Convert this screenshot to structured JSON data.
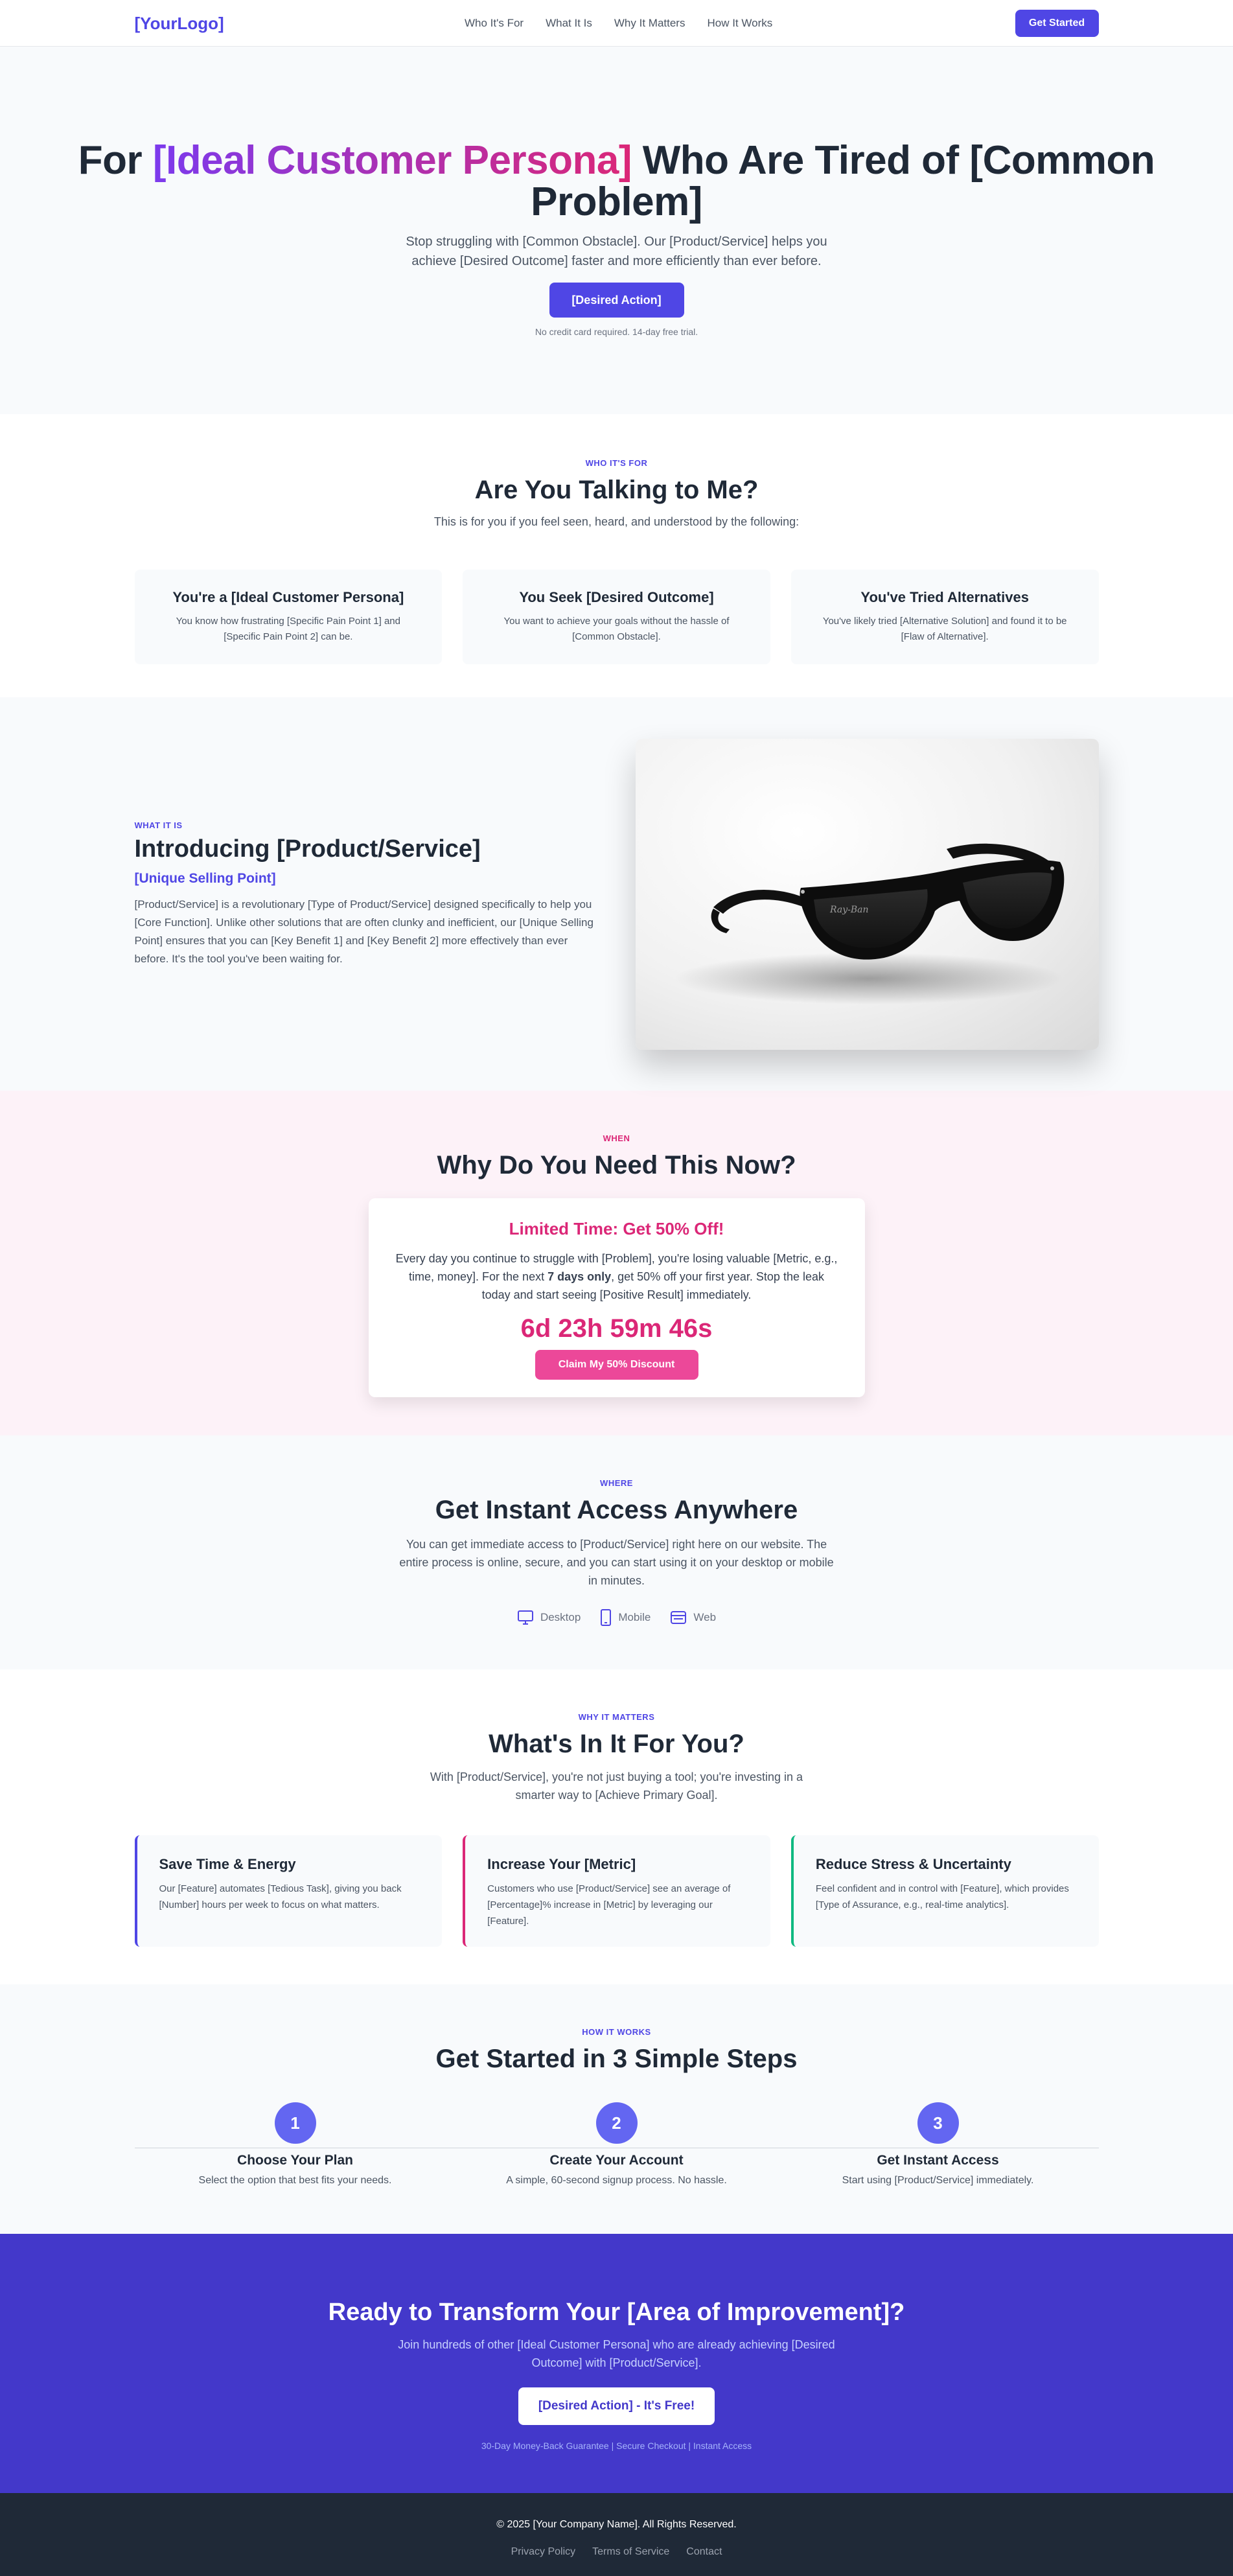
{
  "nav": {
    "logo": "[YourLogo]",
    "links": [
      "Who It's For",
      "What It Is",
      "Why It Matters",
      "How It Works"
    ],
    "cta": "Get Started"
  },
  "hero": {
    "title_start": "For ",
    "title_highlight": "[Ideal Customer Persona]",
    "title_end": " Who Are Tired of [Common Problem]",
    "subtitle": "Stop struggling with [Common Obstacle]. Our [Product/Service] helps you achieve [Desired Outcome] faster and more efficiently than ever before.",
    "cta": "[Desired Action]",
    "note": "No credit card required. 14-day free trial."
  },
  "who": {
    "eyebrow": "WHO IT'S FOR",
    "title": "Are You Talking to Me?",
    "lead": "This is for you if you feel seen, heard, and understood by the following:",
    "cards": [
      {
        "title": "You're a [Ideal Customer Persona]",
        "text": "You know how frustrating [Specific Pain Point 1] and [Specific Pain Point 2] can be."
      },
      {
        "title": "You Seek [Desired Outcome]",
        "text": "You want to achieve your goals without the hassle of [Common Obstacle]."
      },
      {
        "title": "You've Tried Alternatives",
        "text": "You've likely tried [Alternative Solution] and found it to be [Flaw of Alternative]."
      }
    ]
  },
  "what": {
    "eyebrow": "WHAT IT IS",
    "title": "Introducing [Product/Service]",
    "usp": "[Unique Selling Point]",
    "text": "[Product/Service] is a revolutionary [Type of Product/Service] designed specifically to help you [Core Function]. Unlike other solutions that are often clunky and inefficient, our [Unique Selling Point] ensures that you can [Key Benefit 1] and [Key Benefit 2] more effectively than ever before. It's the tool you've been waiting for.",
    "image_logo": "Ray-Ban"
  },
  "when": {
    "eyebrow": "WHEN",
    "title": "Why Do You Need This Now?",
    "offer_title": "Limited Time: Get 50% Off!",
    "offer_text_1": "Every day you continue to struggle with [Problem], you're losing valuable [Metric, e.g., time, money]. For the next ",
    "offer_text_bold": "7 days only",
    "offer_text_2": ", get 50% off your first year. Stop the leak today and start seeing [Positive Result] immediately.",
    "timer": "6d 23h 59m 46s",
    "cta": "Claim My 50% Discount"
  },
  "where": {
    "eyebrow": "WHERE",
    "title": "Get Instant Access Anywhere",
    "lead": "You can get immediate access to [Product/Service] right here on our website. The entire process is online, secure, and you can start using it on your desktop or mobile in minutes.",
    "platforms": [
      "Desktop",
      "Mobile",
      "Web"
    ]
  },
  "why": {
    "eyebrow": "WHY IT MATTERS",
    "title": "What's In It For You?",
    "lead": "With [Product/Service], you're not just buying a tool; you're investing in a smarter way to [Achieve Primary Goal].",
    "features": [
      {
        "title": "Save Time & Energy",
        "text": "Our [Feature] automates [Tedious Task], giving you back [Number] hours per week to focus on what matters.",
        "color": "#4f46e5"
      },
      {
        "title": "Increase Your [Metric]",
        "text": "Customers who use [Product/Service] see an average of [Percentage]% increase in [Metric] by leveraging our [Feature].",
        "color": "#db2777"
      },
      {
        "title": "Reduce Stress & Uncertainty",
        "text": "Feel confident and in control with [Feature], which provides [Type of Assurance, e.g., real-time analytics].",
        "color": "#10b981"
      }
    ]
  },
  "how": {
    "eyebrow": "HOW IT WORKS",
    "title": "Get Started in 3 Simple Steps",
    "steps": [
      {
        "num": "1",
        "title": "Choose Your Plan",
        "text": "Select the option that best fits your needs."
      },
      {
        "num": "2",
        "title": "Create Your Account",
        "text": "A simple, 60-second signup process. No hassle."
      },
      {
        "num": "3",
        "title": "Get Instant Access",
        "text": "Start using [Product/Service] immediately."
      }
    ]
  },
  "cta": {
    "title": "Ready to Transform Your [Area of Improvement]?",
    "lead": "Join hundreds of other [Ideal Customer Persona] who are already achieving [Desired Outcome] with [Product/Service].",
    "button": "[Desired Action] - It's Free!",
    "small": "30-Day Money-Back Guarantee | Secure Checkout | Instant Access"
  },
  "footer": {
    "copy": "© 2025 [Your Company Name]. All Rights Reserved.",
    "links": [
      "Privacy Policy",
      "Terms of Service",
      "Contact"
    ]
  },
  "colors": {
    "primary": "#4f46e5",
    "pink": "#db2777",
    "green": "#10b981",
    "cta_bg": "#4338ca",
    "footer_bg": "#1f2937"
  }
}
